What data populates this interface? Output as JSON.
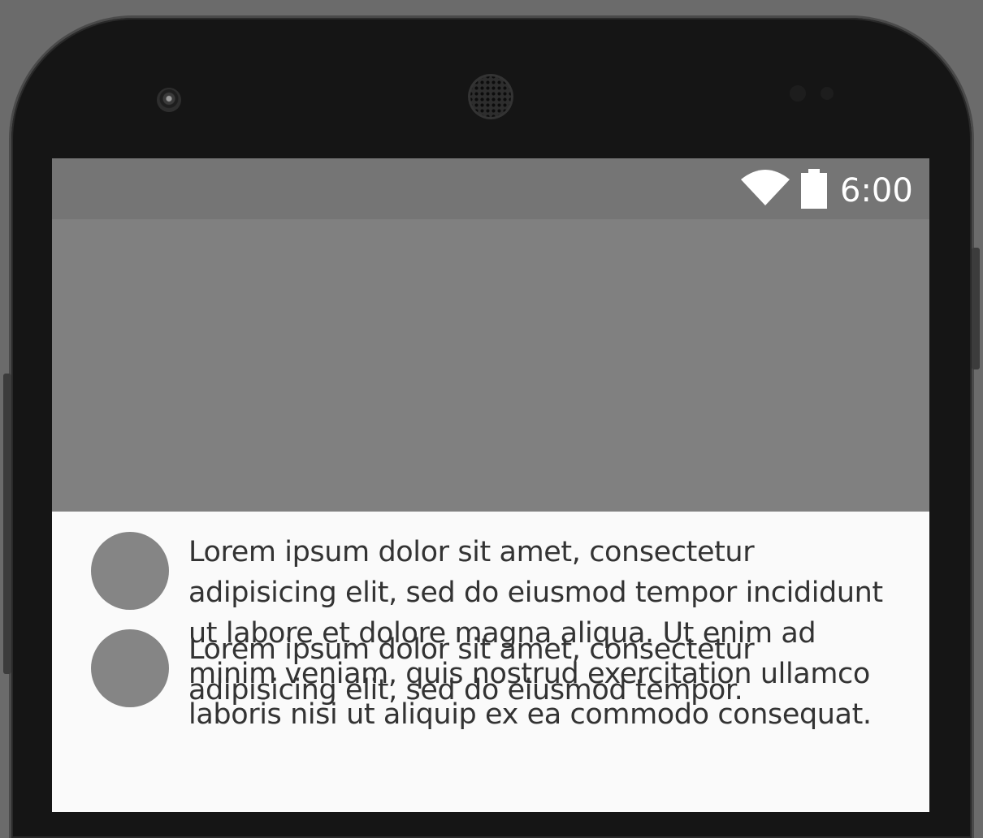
{
  "status_bar": {
    "time": "6:00",
    "icons": [
      "wifi-icon",
      "battery-icon"
    ]
  },
  "list_items": [
    {
      "avatar": "avatar",
      "text": "Lorem ipsum dolor sit amet, consectetur adipisicing elit, sed do eiusmod tempor incididunt ut labore et dolore magna aliqua. Ut enim ad minim veniam, quis nostrud exercitation ullamco laboris nisi ut aliquip ex ea commodo consequat."
    },
    {
      "avatar": "avatar",
      "text": "Lorem ipsum dolor sit amet, consectetur adipisicing elit, sed do eiusmod tempor."
    }
  ],
  "colors": {
    "status_bar": "#757575",
    "app_bar": "#808080",
    "screen_background": "#fafafa",
    "avatar": "#858585",
    "text": "#333333",
    "device_frame": "#151515"
  }
}
